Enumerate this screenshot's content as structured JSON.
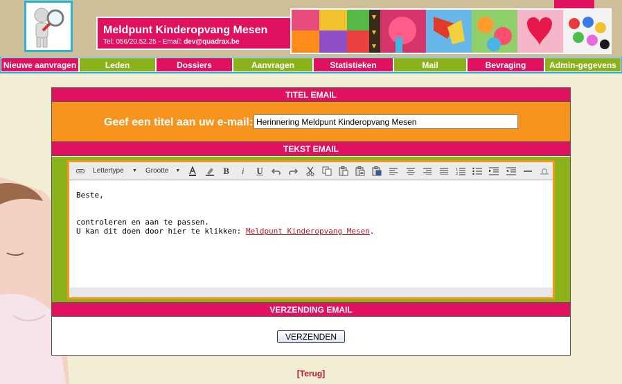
{
  "header": {
    "title": "Meldpunt Kinderopvang Mesen",
    "contact_prefix": "Tel: 056/20.52.25 - Email: ",
    "contact_email": "dev@quadrax.be"
  },
  "nav": [
    {
      "label": "Nieuwe aanvragen",
      "color": "pink"
    },
    {
      "label": "Leden",
      "color": "green"
    },
    {
      "label": "Dossiers",
      "color": "pink"
    },
    {
      "label": "Aanvragen",
      "color": "green"
    },
    {
      "label": "Statistieken",
      "color": "pink"
    },
    {
      "label": "Mail",
      "color": "green"
    },
    {
      "label": "Bevraging",
      "color": "pink"
    },
    {
      "label": "Admin-gegevens",
      "color": "green"
    }
  ],
  "sections": {
    "title_header": "TITEL EMAIL",
    "title_label": "Geef een titel aan uw e-mail:",
    "title_value": "Herinnering Meldpunt Kinderopvang Mesen",
    "text_header": "TEKST EMAIL",
    "send_header": "VERZENDING EMAIL",
    "send_button": "VERZENDEN"
  },
  "editor": {
    "font_select": "Lettertype",
    "size_select": "Grootte",
    "line1": "Beste,",
    "line2": "controleren en aan te passen.",
    "line3_prefix": "U kan dit doen door hier te klikken: ",
    "link_text": "Meldpunt Kinderopvang Mesen",
    "line3_suffix": "."
  },
  "back_link": "[Terug]",
  "colors": {
    "pink": "#e0115f",
    "green": "#8cb21b",
    "orange": "#f7941d",
    "cyan": "#2ab3d9",
    "background": "#f2eed4"
  }
}
